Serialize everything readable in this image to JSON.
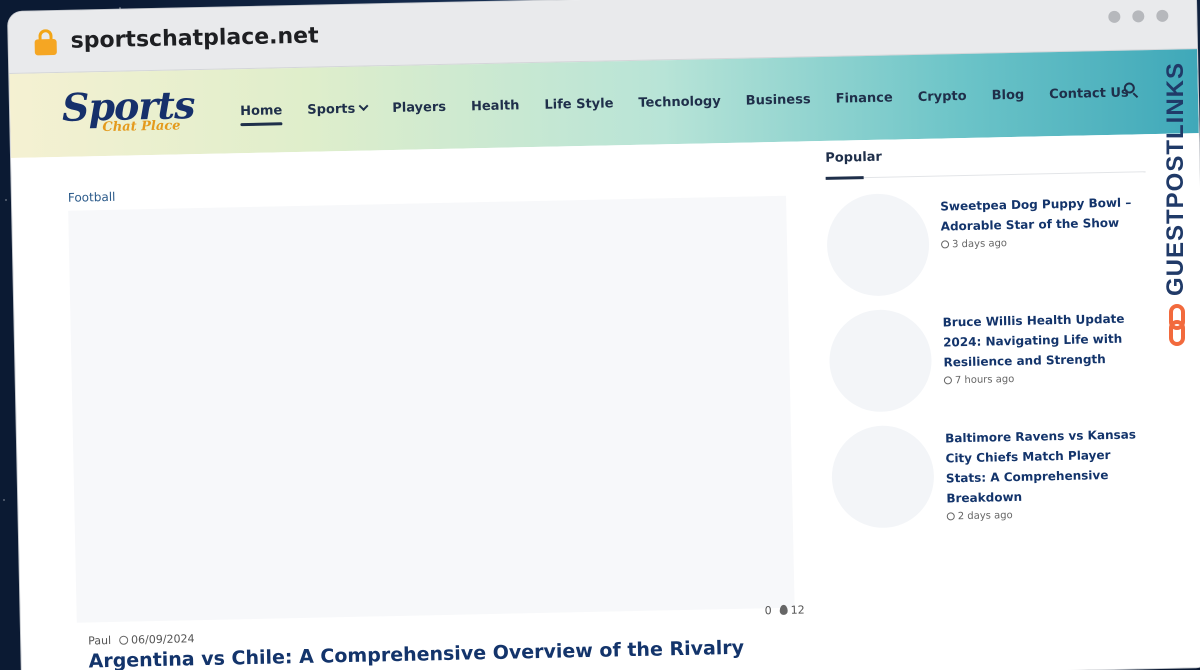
{
  "browser": {
    "url": "sportschatplace.net"
  },
  "header": {
    "logo": {
      "main": "Sports",
      "sub": "Chat Place"
    },
    "nav": [
      {
        "label": "Home",
        "active": true
      },
      {
        "label": "Sports",
        "has_dropdown": true
      },
      {
        "label": "Players"
      },
      {
        "label": "Health"
      },
      {
        "label": "Life Style"
      },
      {
        "label": "Technology"
      },
      {
        "label": "Business"
      },
      {
        "label": "Finance"
      },
      {
        "label": "Crypto"
      },
      {
        "label": "Blog"
      },
      {
        "label": "Contact Us"
      }
    ],
    "search_icon": "search-icon"
  },
  "main": {
    "category": "Football",
    "author": "Paul",
    "date": "06/09/2024",
    "comments": "0",
    "views": "12",
    "title": "Argentina vs Chile: A Comprehensive Overview of the Rivalry"
  },
  "sidebar": {
    "title": "Popular",
    "items": [
      {
        "title": "Sweetpea Dog Puppy Bowl – Adorable Star of the Show",
        "time": "3 days ago"
      },
      {
        "title": "Bruce Willis Health Update 2024: Navigating Life with Resilience and Strength",
        "time": "7 hours ago"
      },
      {
        "title": "Baltimore Ravens vs Kansas City Chiefs Match Player Stats: A Comprehensive Breakdown",
        "time": "2 days ago"
      }
    ]
  },
  "badge": {
    "text": "GUESTPOSTLINKS"
  },
  "colors": {
    "navy": "#13346b",
    "accent": "#f0a21a",
    "badge_link": "#f26a3d"
  }
}
